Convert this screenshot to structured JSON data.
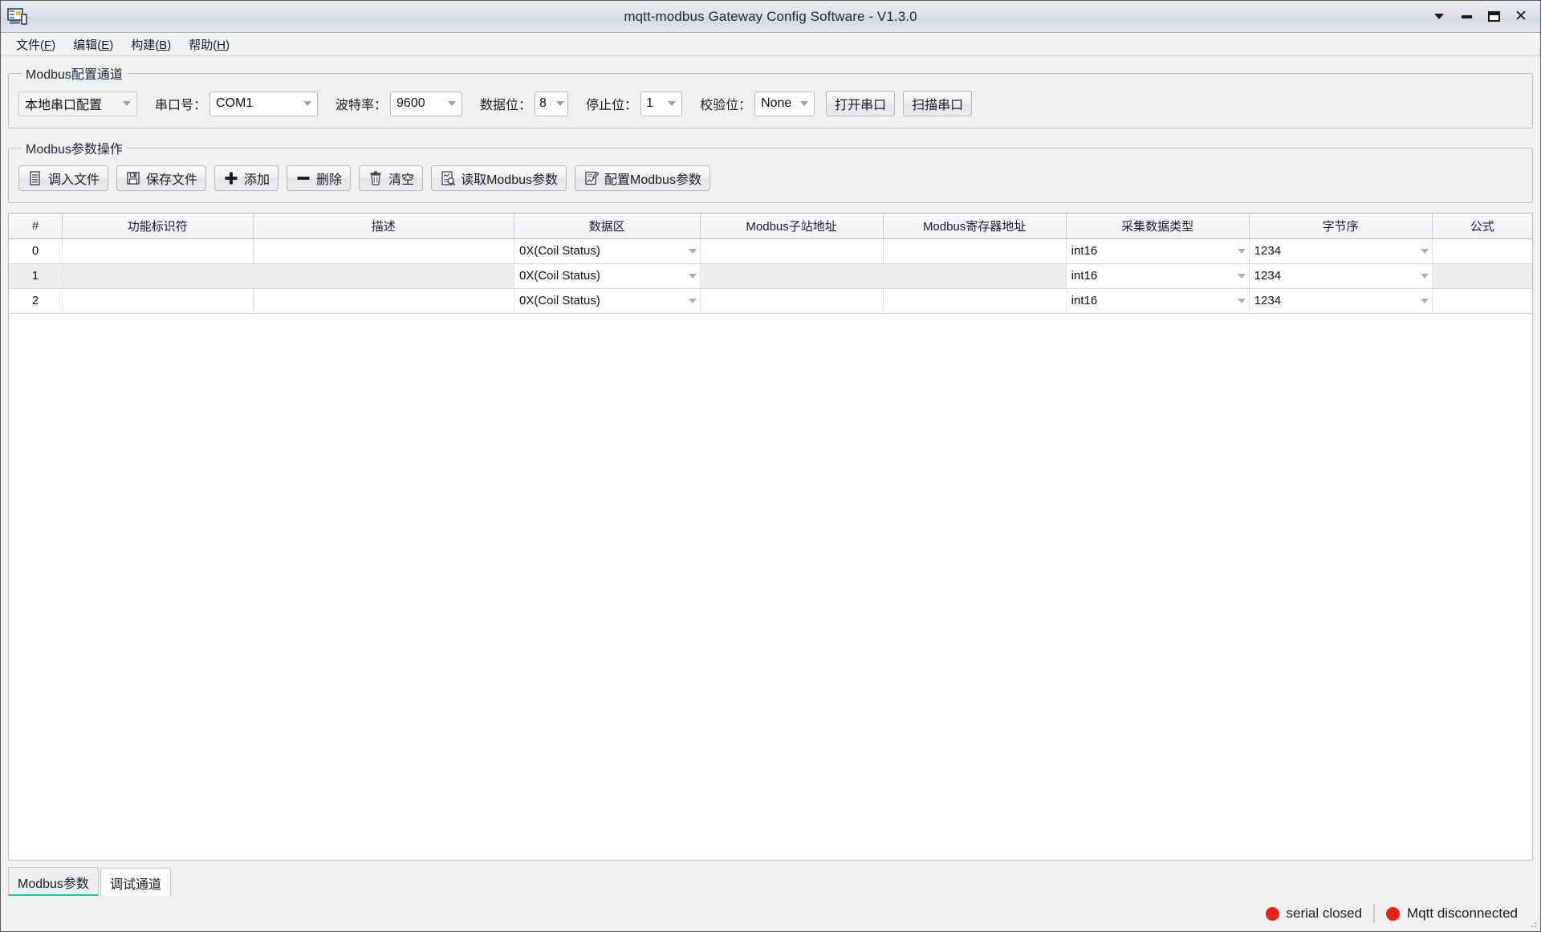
{
  "window": {
    "title": "mqtt-modbus Gateway Config Software - V1.3.0",
    "app_icon": "monitor-icon",
    "controls": {
      "dropdown": "chevron-down-icon",
      "minimize": "minimize-icon",
      "maximize": "maximize-icon",
      "close": "close-icon"
    }
  },
  "menubar": {
    "items": [
      {
        "label": "文件",
        "mnemonic": "F"
      },
      {
        "label": "编辑",
        "mnemonic": "E"
      },
      {
        "label": "构建",
        "mnemonic": "B"
      },
      {
        "label": "帮助",
        "mnemonic": "H"
      }
    ]
  },
  "config_group": {
    "legend": "Modbus配置通道",
    "mode_select": "本地串口配置",
    "port_label": "串口号：",
    "port_value": "COM1",
    "baud_label": "波特率：",
    "baud_value": "9600",
    "databits_label": "数据位：",
    "databits_value": "8",
    "stopbits_label": "停止位：",
    "stopbits_value": "1",
    "parity_label": "校验位：",
    "parity_value": "None",
    "open_port_button": "打开串口",
    "scan_port_button": "扫描串口"
  },
  "param_group": {
    "legend": "Modbus参数操作",
    "buttons": [
      {
        "label": "调入文件",
        "icon": "document-list-icon"
      },
      {
        "label": "保存文件",
        "icon": "floppy-disk-icon"
      },
      {
        "label": "添加",
        "icon": "plus-icon"
      },
      {
        "label": "删除",
        "icon": "minus-icon"
      },
      {
        "label": "清空",
        "icon": "trash-icon"
      },
      {
        "label": "读取Modbus参数",
        "icon": "document-search-icon"
      },
      {
        "label": "配置Modbus参数",
        "icon": "document-edit-icon"
      }
    ]
  },
  "table": {
    "columns": [
      "#",
      "功能标识符",
      "描述",
      "数据区",
      "Modbus子站地址",
      "Modbus寄存器地址",
      "采集数据类型",
      "字节序",
      "公式"
    ],
    "rows": [
      {
        "index": "0",
        "identifier": "",
        "description": "",
        "data_area": "0X(Coil Status)",
        "slave_addr": "",
        "register_addr": "",
        "data_type": "int16",
        "byte_order": "1234",
        "formula": ""
      },
      {
        "index": "1",
        "identifier": "",
        "description": "",
        "data_area": "0X(Coil Status)",
        "slave_addr": "",
        "register_addr": "",
        "data_type": "int16",
        "byte_order": "1234",
        "formula": ""
      },
      {
        "index": "2",
        "identifier": "",
        "description": "",
        "data_area": "0X(Coil Status)",
        "slave_addr": "",
        "register_addr": "",
        "data_type": "int16",
        "byte_order": "1234",
        "formula": ""
      }
    ]
  },
  "tabs": [
    {
      "label": "Modbus参数",
      "active": true
    },
    {
      "label": "调试通道",
      "active": false
    }
  ],
  "statusbar": {
    "serial": {
      "text": "serial closed",
      "color": "#e8231a"
    },
    "mqtt": {
      "text": "Mqtt disconnected",
      "color": "#e8231a"
    }
  }
}
